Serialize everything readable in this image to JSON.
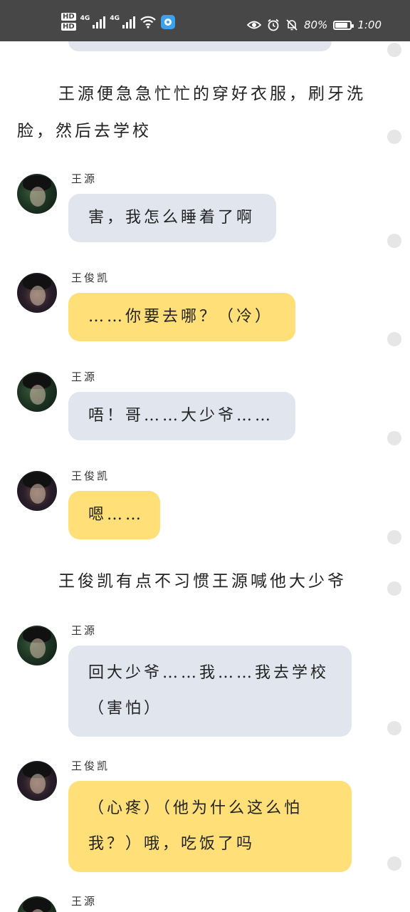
{
  "status_bar": {
    "hd1": "HD",
    "hd2": "HD",
    "net1": "4G",
    "net2": "4G",
    "battery_percent": "80%",
    "time": "1:00",
    "icons": [
      "hd-icon",
      "signal-icon",
      "wifi-icon",
      "app-icon",
      "eye-icon",
      "alarm-icon",
      "mute-bell-icon",
      "battery-icon"
    ]
  },
  "story": {
    "narration_1": "王源便急急忙忙的穿好衣服，刷牙洗脸，然后去学校",
    "narration_2": "王俊凯有点不习惯王源喊他大少爷",
    "messages": [
      {
        "sender": "王源",
        "text": "害，我怎么睡着了啊"
      },
      {
        "sender": "王俊凯",
        "text": "……你要去哪？（冷）"
      },
      {
        "sender": "王源",
        "text": "唔！哥……大少爷……"
      },
      {
        "sender": "王俊凯",
        "text": "嗯……"
      },
      {
        "sender": "王源",
        "text": "回大少爷……我……我去学校（害怕）"
      },
      {
        "sender": "王俊凯",
        "text": "（心疼）（他为什么这么怕我？）哦，吃饭了吗"
      },
      {
        "sender": "王源",
        "text": ""
      }
    ]
  },
  "colors": {
    "status_bar": "#474747",
    "bubble_wang_yuan": "#e1e6ee",
    "bubble_wang_junkai": "#ffdf78",
    "dot": "#e6e6e6"
  }
}
